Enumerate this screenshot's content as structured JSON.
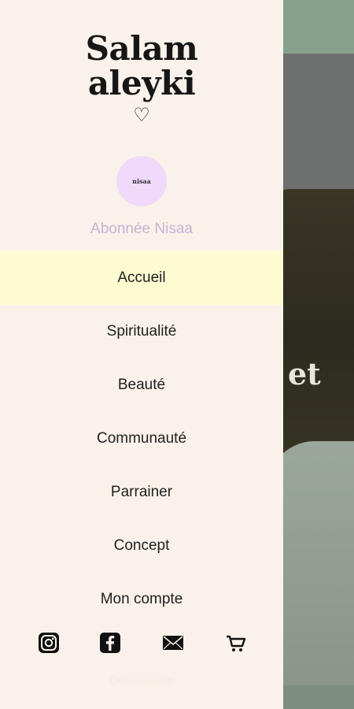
{
  "background": {
    "visible_word": "et"
  },
  "drawer": {
    "logo_line1": "Salam",
    "logo_line2": "aleyki",
    "logo_heart": "♡",
    "avatar_text": "nisaa",
    "subscriber_label": "Abonnée Nisaa",
    "menu": [
      {
        "label": "Accueil",
        "active": true
      },
      {
        "label": "Spiritualité",
        "active": false
      },
      {
        "label": "Beauté",
        "active": false
      },
      {
        "label": "Communauté",
        "active": false
      },
      {
        "label": "Parrainer",
        "active": false
      },
      {
        "label": "Concept",
        "active": false
      },
      {
        "label": "Mon compte",
        "active": false
      }
    ],
    "footer_icons": [
      "instagram-icon",
      "facebook-icon",
      "mail-icon",
      "cart-icon"
    ],
    "faded_footer_text": "Déconnexion"
  },
  "colors": {
    "drawer_bg": "#faf2ea",
    "active_item_bg": "#fdfbd2",
    "subscriber_text": "#c7b3d3",
    "avatar_bg": "#f1d9fb"
  }
}
